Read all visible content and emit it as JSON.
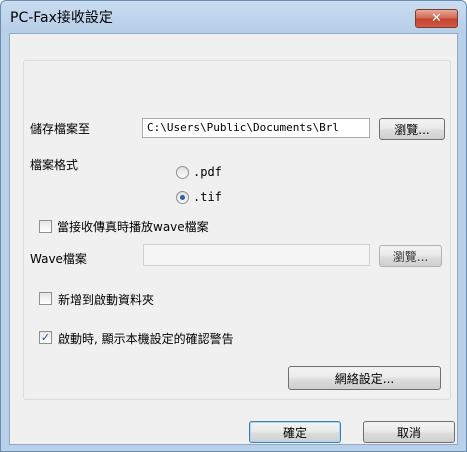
{
  "window": {
    "title": "PC-Fax接收設定",
    "close_glyph": "✕"
  },
  "save": {
    "label": "儲存檔案至",
    "path": "C:\\Users\\Public\\Documents\\Brl",
    "browse_label": "瀏覽..."
  },
  "format": {
    "label": "檔案格式",
    "options": [
      {
        "label": ".pdf",
        "selected": false
      },
      {
        "label": ".tif",
        "selected": true
      }
    ]
  },
  "wave": {
    "play_checkbox_label": "當接收傳真時播放wave檔案",
    "play_checked": false,
    "file_label": "Wave檔案",
    "file_value": "",
    "browse_label": "瀏覽..."
  },
  "startup": {
    "label": "新增到啟動資料夾",
    "checked": false
  },
  "warning": {
    "label": "啟動時, 顯示本機設定的確認警告",
    "checked": true
  },
  "buttons": {
    "network": "網絡設定...",
    "ok": "確定",
    "cancel": "取消"
  },
  "colors": {
    "accent": "#2b5fa8",
    "close": "#c24330"
  }
}
